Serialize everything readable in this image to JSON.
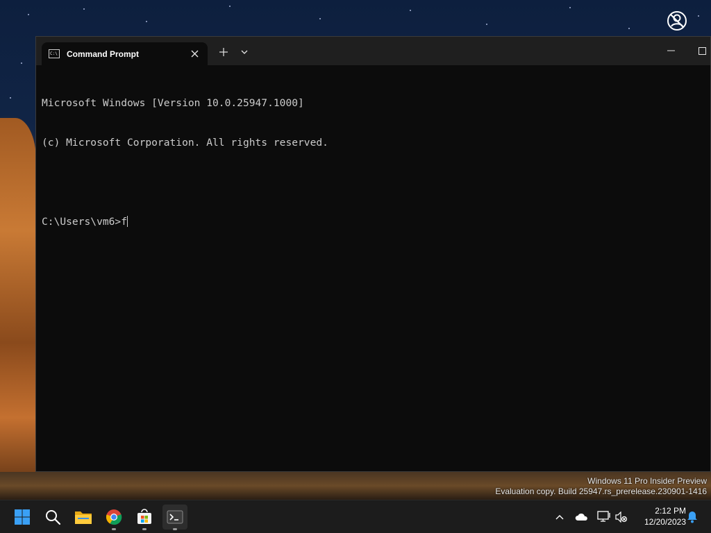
{
  "window": {
    "tab_title": "Command Prompt",
    "tab_icon": "cmd-icon",
    "new_tab_symbol": "+",
    "close_symbol": "✕"
  },
  "console": {
    "lines": [
      "Microsoft Windows [Version 10.0.25947.1000]",
      "(c) Microsoft Corporation. All rights reserved.",
      "",
      "C:\\Users\\vm6>f"
    ]
  },
  "watermark": {
    "line1": "Windows 11 Pro Insider Preview",
    "line2": "Evaluation copy. Build 25947.rs_prerelease.230901-1416"
  },
  "taskbar": {
    "apps": [
      "start-icon",
      "search-icon",
      "file-explorer-icon",
      "chrome-icon",
      "store-icon",
      "terminal-icon"
    ],
    "clock_time": "2:12 PM",
    "clock_date": "12/20/2023"
  },
  "colors": {
    "console_bg": "#0c0c0c",
    "console_fg": "#cccccc",
    "titlebar_bg": "#1f1f1f",
    "taskbar_bg": "#1c1c1c",
    "windows_blue": "#3aa0f5"
  }
}
